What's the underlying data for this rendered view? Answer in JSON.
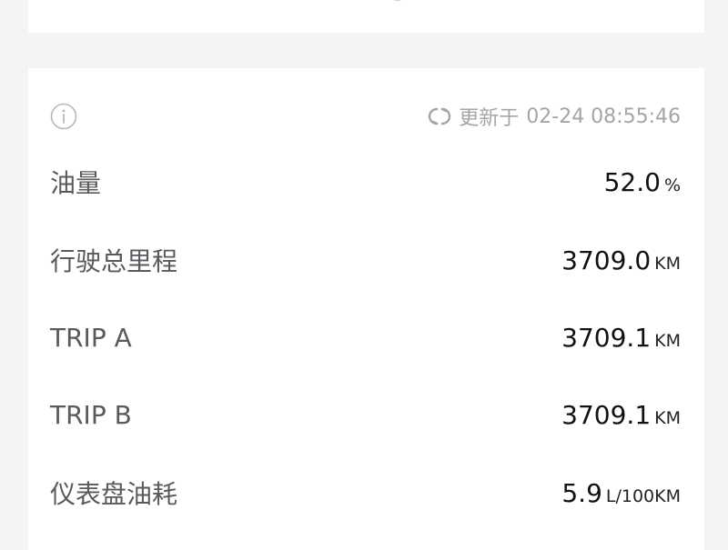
{
  "status": {
    "update_prefix": "更新于",
    "update_time": "02-24 08:55:46"
  },
  "metrics": [
    {
      "label": "油量",
      "value": "52.0",
      "unit": "%"
    },
    {
      "label": "行驶总里程",
      "value": "3709.0",
      "unit": "KM"
    },
    {
      "label": "TRIP A",
      "value": "3709.1",
      "unit": "KM"
    },
    {
      "label": "TRIP B",
      "value": "3709.1",
      "unit": "KM"
    },
    {
      "label": "仪表盘油耗",
      "value": "5.9",
      "unit": "L/100KM"
    }
  ],
  "icons": {
    "info": "info-icon",
    "refresh": "refresh-icon"
  },
  "colors": {
    "background": "#f4f4f6",
    "card": "#ffffff",
    "muted_text": "#a5a5a9",
    "label_text": "#5a5a5e",
    "value_text": "#111111"
  }
}
